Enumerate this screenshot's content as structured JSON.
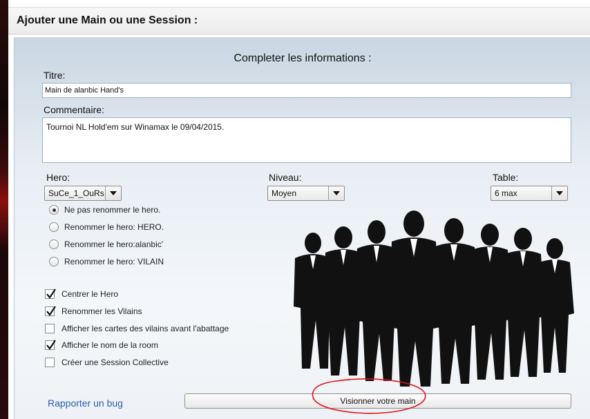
{
  "dialog": {
    "title": "Ajouter une Main ou une Session :"
  },
  "form": {
    "heading": "Completer les informations :",
    "titre_label": "Titre:",
    "titre_value": "Main de alanbic Hand's",
    "commentaire_label": "Commentaire:",
    "commentaire_value": "Tournoi NL Hold'em sur Winamax le 09/04/2015."
  },
  "hero": {
    "label": "Hero:",
    "selected": "SuCe_1_OuRs"
  },
  "niveau": {
    "label": "Niveau:",
    "selected": "Moyen"
  },
  "table": {
    "label": "Table:",
    "selected": "6 max"
  },
  "rename_options": [
    {
      "label": "Ne pas renommer le hero.",
      "selected": true
    },
    {
      "label": "Renommer le hero: HERO.",
      "selected": false
    },
    {
      "label": "Renommer le hero:alanbic'",
      "selected": false
    },
    {
      "label": "Renommer le hero: VILAIN",
      "selected": false
    }
  ],
  "checkboxes": [
    {
      "label": "Centrer le Hero",
      "checked": true
    },
    {
      "label": "Renommer les Vilains",
      "checked": true
    },
    {
      "label": "Afficher les cartes des vilains avant l'abattage",
      "checked": false
    },
    {
      "label": "Afficher le nom de la room",
      "checked": true
    },
    {
      "label": "Créer une Session Collective",
      "checked": false
    }
  ],
  "footer": {
    "bug_link": "Rapporter un bug",
    "submit_label": "Visionner votre main"
  },
  "colors": {
    "link": "#2a5db0",
    "annotation": "#e0141b",
    "panel_top": "#c9d6e2"
  }
}
